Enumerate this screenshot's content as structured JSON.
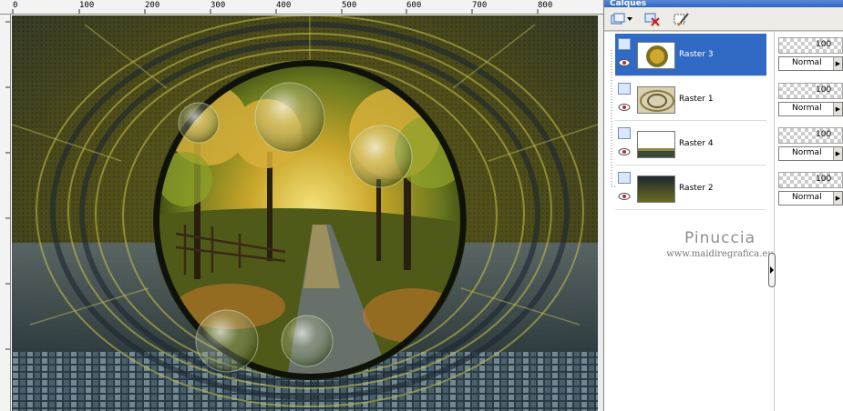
{
  "panel": {
    "title": "Calques"
  },
  "ruler": {
    "top_ticks": [
      "0",
      "100",
      "200",
      "300",
      "400",
      "500",
      "600",
      "700",
      "800"
    ]
  },
  "layers": [
    {
      "name": "Raster 3",
      "selected": true,
      "opacity": "100",
      "blend": "Normal"
    },
    {
      "name": "Raster 1",
      "selected": false,
      "opacity": "100",
      "blend": "Normal"
    },
    {
      "name": "Raster 4",
      "selected": false,
      "opacity": "100",
      "blend": "Normal"
    },
    {
      "name": "Raster 2",
      "selected": false,
      "opacity": "100",
      "blend": "Normal"
    }
  ],
  "watermark": {
    "title": "Pinuccia",
    "url": "www.maidiregrafica.eu"
  },
  "colors": {
    "selection": "#316ac5",
    "panel_bg": "#d4d0c8"
  }
}
